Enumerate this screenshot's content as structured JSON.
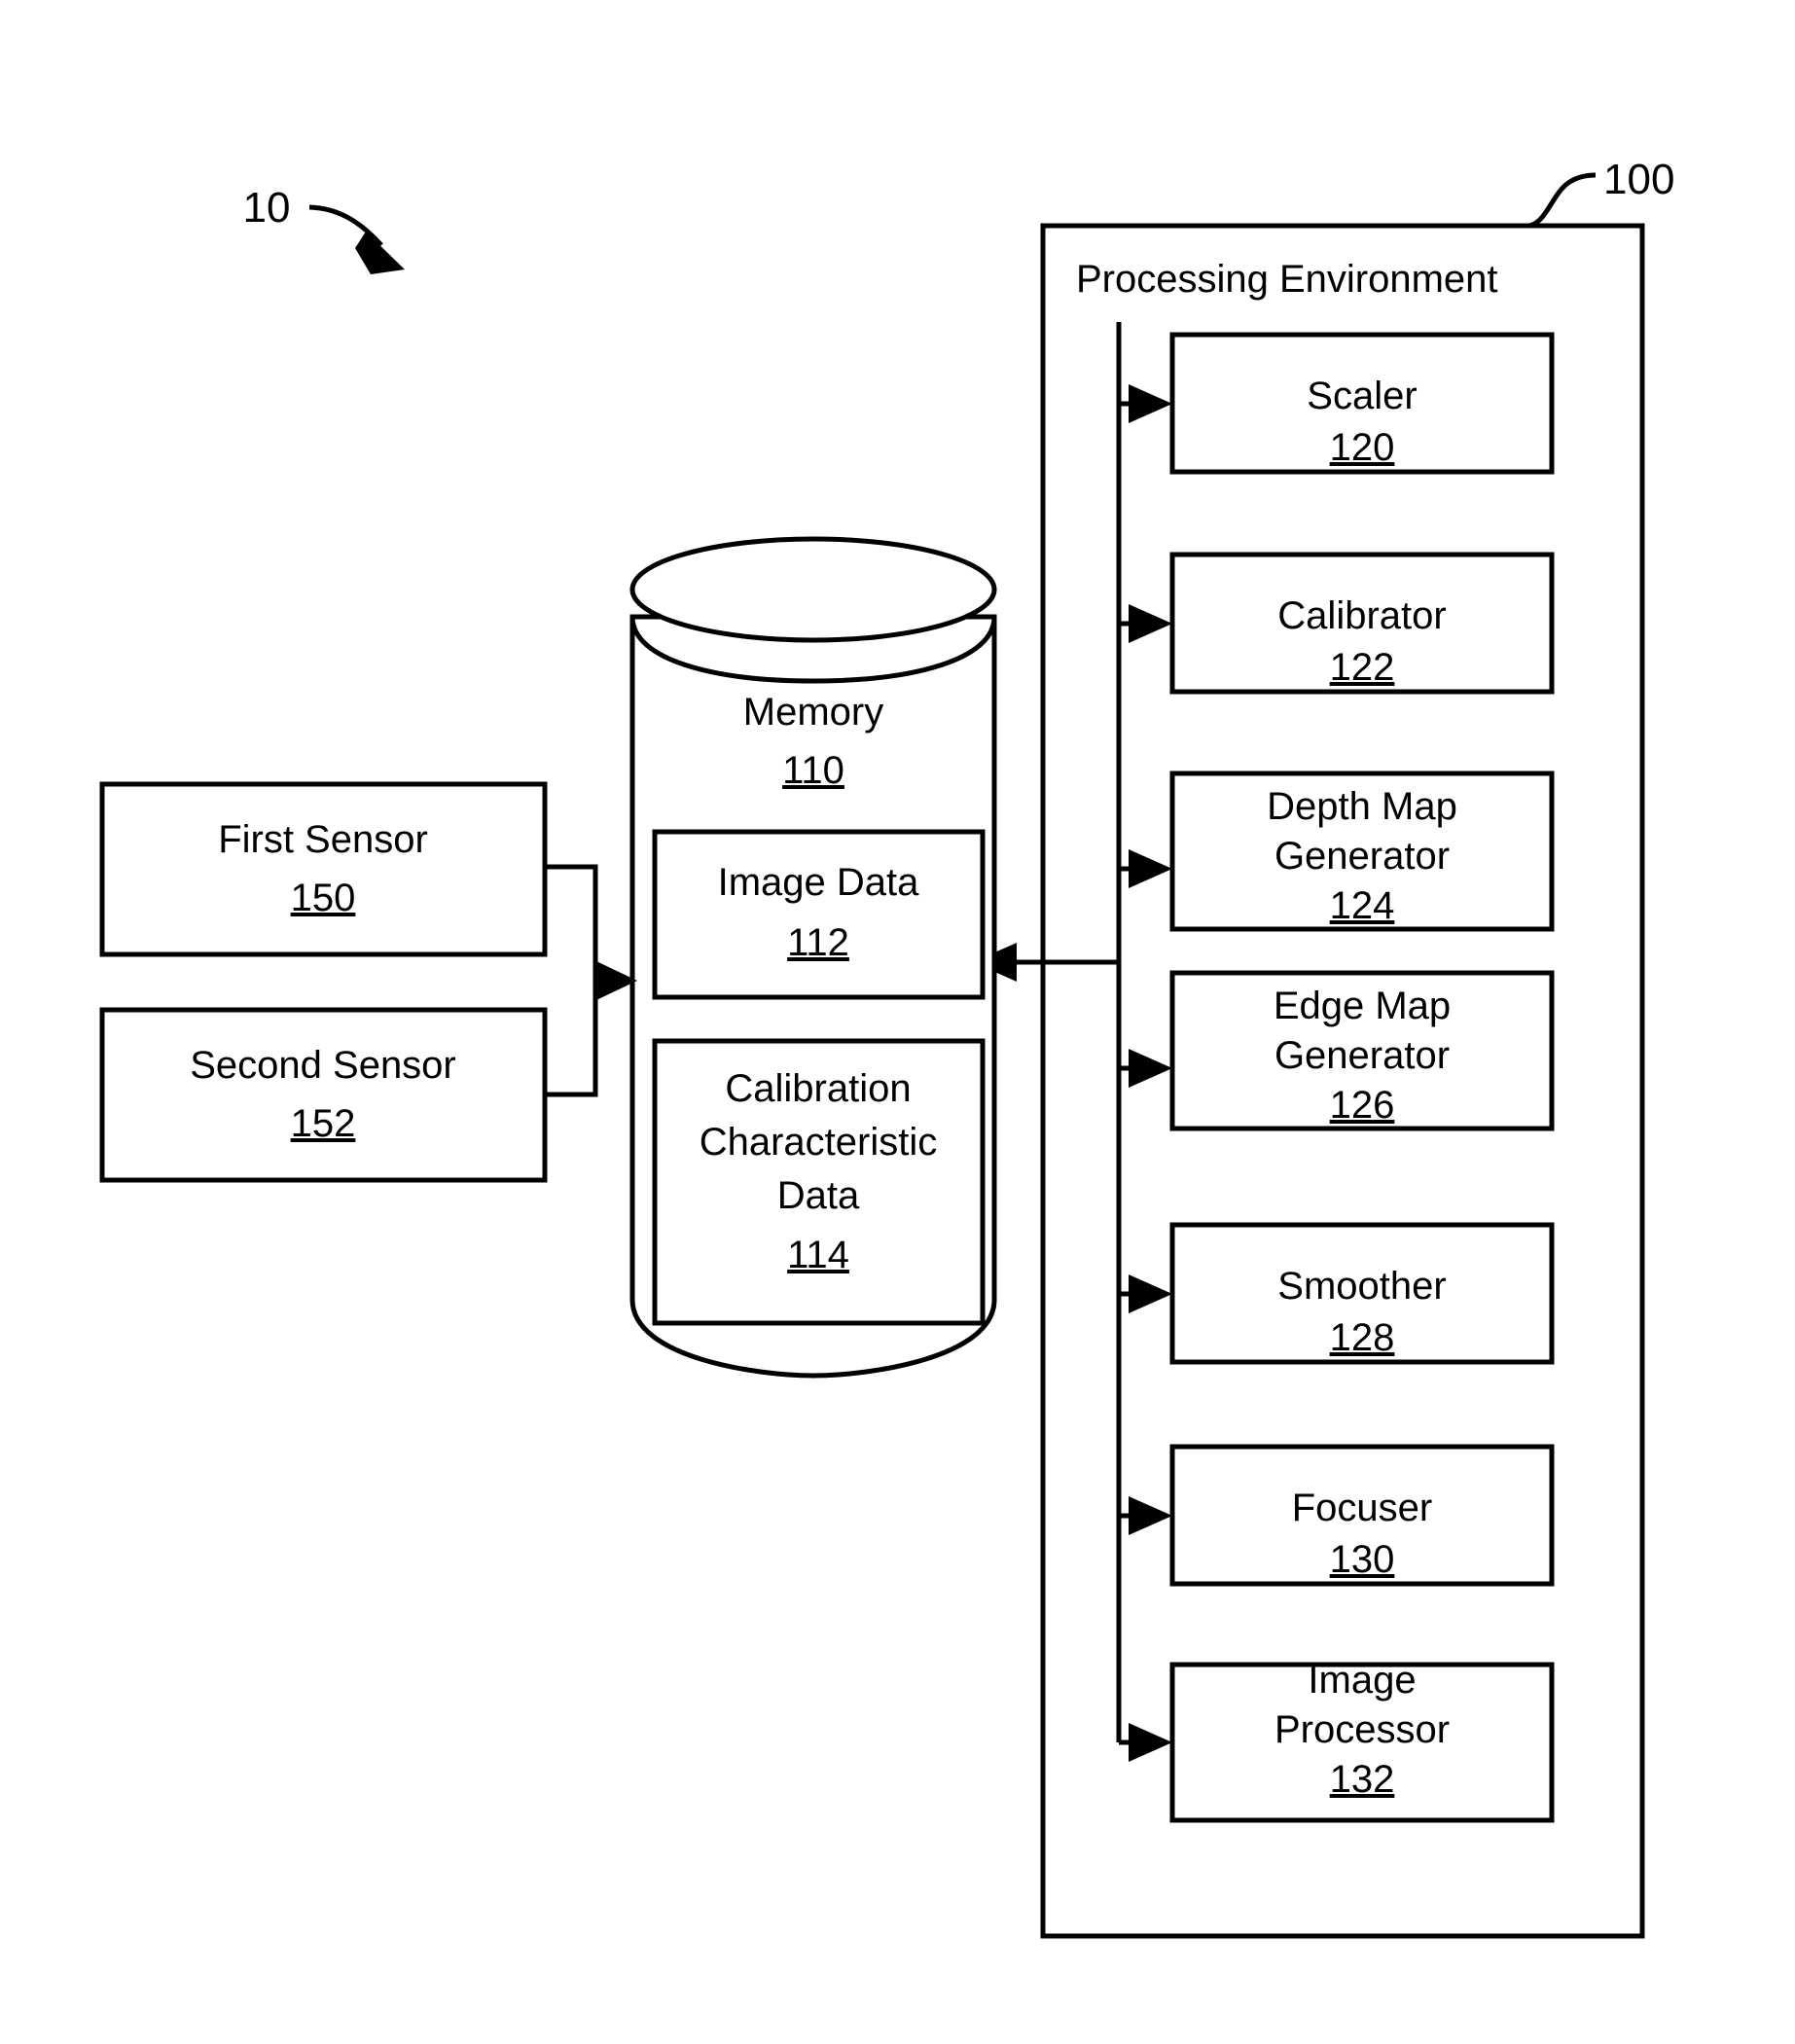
{
  "figure": {
    "figure_label": "10",
    "system_label": "100"
  },
  "processing_environment": {
    "title": "Processing Environment",
    "modules": [
      {
        "name": "Scaler",
        "name_line2": "",
        "ref": "120"
      },
      {
        "name": "Calibrator",
        "name_line2": "",
        "ref": "122"
      },
      {
        "name": "Depth Map",
        "name_line2": "Generator",
        "ref": "124"
      },
      {
        "name": "Edge Map",
        "name_line2": "Generator",
        "ref": "126"
      },
      {
        "name": "Smoother",
        "name_line2": "",
        "ref": "128"
      },
      {
        "name": "Focuser",
        "name_line2": "",
        "ref": "130"
      },
      {
        "name": "Image",
        "name_line2": "Processor",
        "ref": "132"
      }
    ]
  },
  "memory": {
    "title": "Memory",
    "ref": "110",
    "contents": [
      {
        "lines": [
          "Image Data"
        ],
        "ref": "112"
      },
      {
        "lines": [
          "Calibration",
          "Characteristic",
          "Data"
        ],
        "ref": "114"
      }
    ]
  },
  "sensors": [
    {
      "name": "First Sensor",
      "ref": "150"
    },
    {
      "name": "Second Sensor",
      "ref": "152"
    }
  ],
  "colors": {
    "stroke": "#000000",
    "background": "#ffffff"
  }
}
